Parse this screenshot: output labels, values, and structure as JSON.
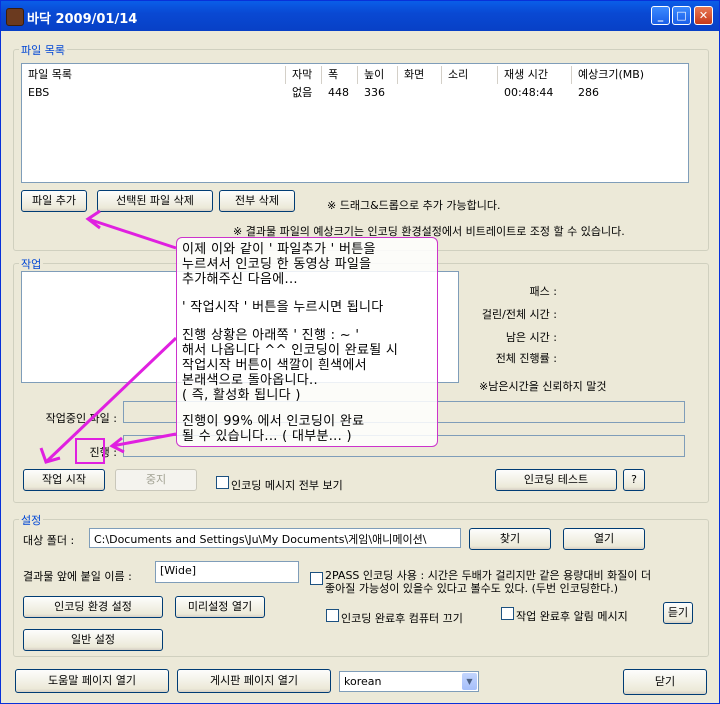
{
  "window": {
    "title": "바닥 2009/01/14",
    "min_label": "_",
    "max_label": "□",
    "close_label": "✕"
  },
  "filelist": {
    "group_label": "파일 목록",
    "columns": [
      "파일 목록",
      "자막",
      "폭",
      "높이",
      "화면",
      "소리",
      "재생 시간",
      "예상크기(MB)"
    ],
    "rows": [
      [
        "EBS",
        "없음",
        "448",
        "336",
        "",
        "",
        "00:48:44",
        "286"
      ]
    ],
    "add_button": "파일 추가",
    "delete_selected_button": "선택된 파일 삭제",
    "delete_all_button": "전부 삭제",
    "dragdrop_note": "※ 드래그&드롭으로 추가 가능합니다.",
    "size_note": "※ 결과물 파일의 예상크기는 인코딩 환경설정에서 비트레이트로 조정 할 수 있습니다."
  },
  "job": {
    "group_label": "작업",
    "pass_label": "패스 :",
    "elapsed_label": "걸린/전체 시간 :",
    "remaining_label": "남은 시간 :",
    "total_progress_label": "전체 진행률 :",
    "remaining_note": "※남은시간을 신뢰하지 말것",
    "current_file_label": "작업중인 파일 :",
    "progress_label": "진행 :",
    "start_button": "작업 시작",
    "stop_button": "중지",
    "show_all_messages": "인코딩 메시지 전부 보기",
    "encoding_test_button": "인코딩 테스트",
    "help_button": "?"
  },
  "annotation": {
    "lines": [
      "이제 이와 같이 ' 파일추가 ' 버튼을",
      "누르셔서 인코딩 한 동영상 파일을",
      "추가해주신 다음에...",
      "' 작업시작 ' 버튼을 누르시면 됩니다",
      "진행 상황은 아래쪽 ' 진행 : ~ '",
      "해서 나옵니다 ^^ 인코딩이 완료될 시",
      "작업시작 버튼이 색깔이 흰색에서",
      "본래색으로 돌아옵니다..",
      "( 즉, 활성화 됩니다 )",
      "진행이 99% 에서 인코딩이 완료",
      "될 수 있습니다... ( 대부분... )"
    ],
    "color": "#e020e0"
  },
  "settings": {
    "group_label": "설정",
    "target_folder_label": "대상 폴더 :",
    "target_folder_value": "C:\\Documents and Settings\\Ju\\My Documents\\게임\\애니메이션\\",
    "browse_button": "찾기",
    "open_button": "열기",
    "prefix_label": "결과물 앞에 붙일 이름 :",
    "prefix_value": "[Wide]",
    "twopass_line1": "2PASS 인코딩 사용 : 시간은 두배가 걸리지만 같은 용량대비 화질이 더",
    "twopass_line2": "좋아질 가능성이 있을수 있다고 볼수도 있다. (두번 인코딩한다.)",
    "encoding_settings_button": "인코딩 환경 설정",
    "preset_open_button": "미리설정 열기",
    "general_settings_button": "일반 설정",
    "shutdown_after": "인코딩 완료후 컴퓨터 끄기",
    "alarm_after": "작업 완료후 알림 메시지",
    "listen_button": "듣기"
  },
  "footer": {
    "help_page_button": "도움말 페이지 열기",
    "board_page_button": "게시판 페이지 열기",
    "language_value": "korean",
    "close_button": "닫기"
  }
}
